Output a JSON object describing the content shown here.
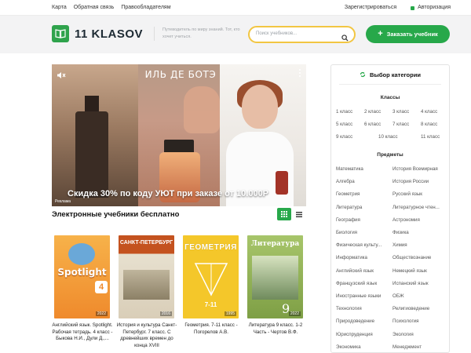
{
  "topbar": {
    "links": [
      "Карта",
      "Обратная связь",
      "Правообладателям"
    ],
    "register": "Зарегистрироваться",
    "login": "Авторизация"
  },
  "header": {
    "logo": "11 KLASOV",
    "tagline": "Путеводитель по миру знаний. Тот, кто хочет учиться.",
    "search_placeholder": "Поиск учебников...",
    "order_button": "Заказать учебник"
  },
  "banner": {
    "brand": "ИЛЬ ДЕ БОТЭ",
    "promo": "Скидка 30% по коду УЮТ при заказе от 10.000Р",
    "ad_label": "Реклама"
  },
  "section": {
    "title": "Электронные учебники бесплатно"
  },
  "books": [
    {
      "caption": "Английский язык. Spotlight. Рабочая тетрадь. 4 класс - Быкова Н.И., Дули Д.,...",
      "cover_text": "Spotlight",
      "cover_color": "#f39a3a",
      "year": "2022"
    },
    {
      "caption": "История и культура Санкт-Петербург. 7 класс. С древнейших времен до конца XVIII",
      "cover_text": "САНКТ-ПЕТЕРБУРГ",
      "cover_color": "#b8471d",
      "year": "2016"
    },
    {
      "caption": "Геометрия. 7-11 класс - Погорелов А.В.",
      "cover_text": "ГЕОМЕТРИЯ",
      "cover_color": "#f4c72a",
      "year": "1995"
    },
    {
      "caption": "Литература 9 класс. 1-2 Часть - Чертов В.Ф.",
      "cover_text": "Литература",
      "cover_color": "#8fb04f",
      "year": "2022"
    }
  ],
  "sidebar": {
    "title": "Выбор категории",
    "classes_title": "Классы",
    "classes": [
      "1 класс",
      "2 класс",
      "3 класс",
      "4 класс",
      "5 класс",
      "6 класс",
      "7 класс",
      "8 класс",
      "9 класс",
      "10 класс",
      "11 класс"
    ],
    "subjects_title": "Предметы",
    "subjects": [
      "Математика",
      "История Всемирная",
      "Алгебра",
      "История России",
      "Геометрия",
      "Русский язык",
      "Литература",
      "Литературное чтен...",
      "География",
      "Астрономия",
      "Биология",
      "Физика",
      "Физическая культу...",
      "Химия",
      "Информатика",
      "Обществознание",
      "Английский язык",
      "Немецкий язык",
      "Французский язык",
      "Испанский язык",
      "Иностранные языки",
      "ОБЖ",
      "Технология",
      "Религиоведение",
      "Природоведение",
      "Психология",
      "Юриспруденция",
      "Экология",
      "Экономика",
      "Менеджмент"
    ]
  },
  "colors": {
    "accent": "#27a84a",
    "search_border": "#f2c642"
  }
}
